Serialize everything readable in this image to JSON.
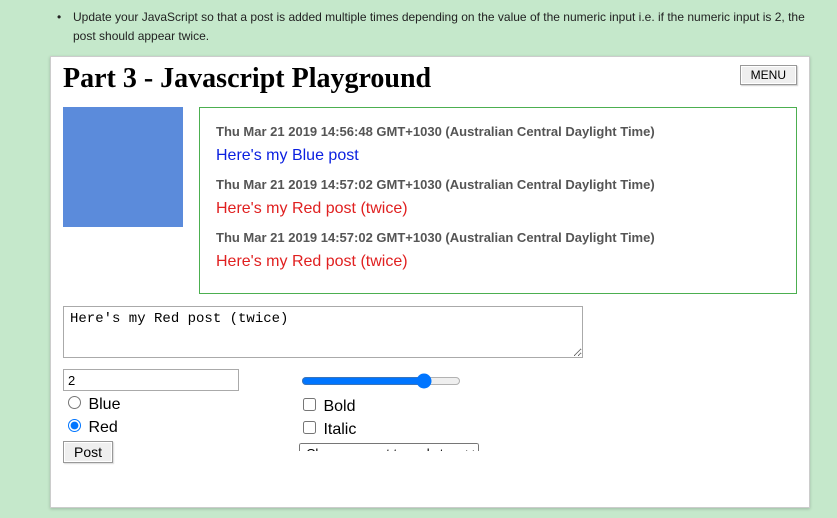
{
  "note": "Update your JavaScript so that a post is added multiple times depending on the value of the numeric input i.e. if the numeric input is 2, the post should appear twice.",
  "header": {
    "title": "Part 3 - Javascript Playground",
    "menu_label": "MENU"
  },
  "swatch_color": "#5b8bdb",
  "posts": [
    {
      "timestamp": "Thu Mar 21 2019 14:56:48 GMT+1030 (Australian Central Daylight Time)",
      "text": "Here's my Blue post",
      "color": "blue"
    },
    {
      "timestamp": "Thu Mar 21 2019 14:57:02 GMT+1030 (Australian Central Daylight Time)",
      "text": "Here's my Red post (twice)",
      "color": "red"
    },
    {
      "timestamp": "Thu Mar 21 2019 14:57:02 GMT+1030 (Australian Central Daylight Time)",
      "text": "Here's my Red post (twice)",
      "color": "red"
    }
  ],
  "compose": {
    "textarea_value": "Here's my Red post (twice)",
    "number_value": "2",
    "slider_value": "80",
    "colors": {
      "blue_label": "Blue",
      "red_label": "Red",
      "selected": "red"
    },
    "styles": {
      "bold_label": "Bold",
      "italic_label": "Italic"
    },
    "post_button": "Post",
    "reply_placeholder": "Choose a post to reply to"
  }
}
